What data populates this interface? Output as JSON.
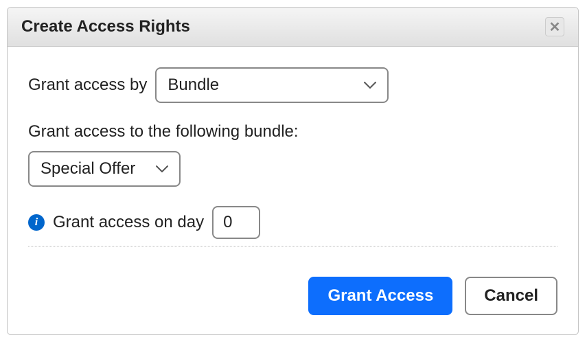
{
  "dialog": {
    "title": "Create Access Rights"
  },
  "form": {
    "grant_by_label": "Grant access by",
    "grant_by_value": "Bundle",
    "bundle_section_label": "Grant access to the following bundle:",
    "bundle_value": "Special Offer",
    "day_label": "Grant access on day",
    "day_value": "0"
  },
  "buttons": {
    "primary": "Grant Access",
    "cancel": "Cancel"
  }
}
